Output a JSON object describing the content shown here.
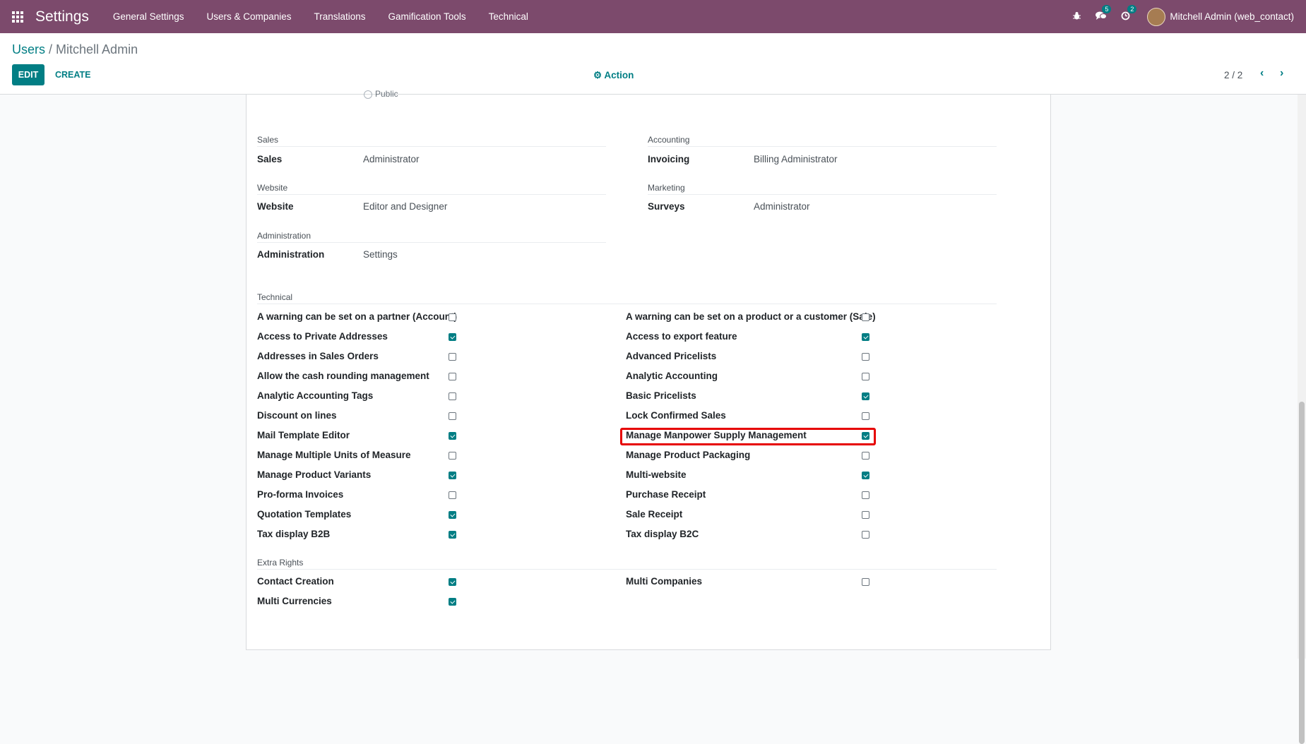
{
  "navbar": {
    "brand": "Settings",
    "menu": [
      "General Settings",
      "Users & Companies",
      "Translations",
      "Gamification Tools",
      "Technical"
    ],
    "chat_badge": "5",
    "activity_badge": "2",
    "user": "Mitchell Admin (web_contact)"
  },
  "breadcrumb": {
    "parent": "Users",
    "separator": " / ",
    "current": "Mitchell Admin"
  },
  "controls": {
    "edit": "EDIT",
    "create": "CREATE",
    "action": "Action",
    "pager": "2 / 2"
  },
  "partial_radio": "Public",
  "sections": {
    "sales": {
      "title": "Sales",
      "label": "Sales",
      "value": "Administrator"
    },
    "accounting": {
      "title": "Accounting",
      "label": "Invoicing",
      "value": "Billing Administrator"
    },
    "website": {
      "title": "Website",
      "label": "Website",
      "value": "Editor and Designer"
    },
    "marketing": {
      "title": "Marketing",
      "label": "Surveys",
      "value": "Administrator"
    },
    "administration": {
      "title": "Administration",
      "label": "Administration",
      "value": "Settings"
    }
  },
  "technical": {
    "title": "Technical",
    "left": [
      {
        "label": "A warning can be set on a partner (Account)",
        "checked": false
      },
      {
        "label": "Access to Private Addresses",
        "checked": true
      },
      {
        "label": "Addresses in Sales Orders",
        "checked": false
      },
      {
        "label": "Allow the cash rounding management",
        "checked": false
      },
      {
        "label": "Analytic Accounting Tags",
        "checked": false
      },
      {
        "label": "Discount on lines",
        "checked": false
      },
      {
        "label": "Mail Template Editor",
        "checked": true
      },
      {
        "label": "Manage Multiple Units of Measure",
        "checked": false
      },
      {
        "label": "Manage Product Variants",
        "checked": true
      },
      {
        "label": "Pro-forma Invoices",
        "checked": false
      },
      {
        "label": "Quotation Templates",
        "checked": true
      },
      {
        "label": "Tax display B2B",
        "checked": true
      }
    ],
    "right": [
      {
        "label": "A warning can be set on a product or a customer (Sale)",
        "checked": false
      },
      {
        "label": "Access to export feature",
        "checked": true
      },
      {
        "label": "Advanced Pricelists",
        "checked": false
      },
      {
        "label": "Analytic Accounting",
        "checked": false
      },
      {
        "label": "Basic Pricelists",
        "checked": true
      },
      {
        "label": "Lock Confirmed Sales",
        "checked": false
      },
      {
        "label": "Manage Manpower Supply Management",
        "checked": true
      },
      {
        "label": "Manage Product Packaging",
        "checked": false
      },
      {
        "label": "Multi-website",
        "checked": true
      },
      {
        "label": "Purchase Receipt",
        "checked": false
      },
      {
        "label": "Sale Receipt",
        "checked": false
      },
      {
        "label": "Tax display B2C",
        "checked": false
      }
    ]
  },
  "extra_rights": {
    "title": "Extra Rights",
    "left": [
      {
        "label": "Contact Creation",
        "checked": true
      },
      {
        "label": "Multi Currencies",
        "checked": true
      }
    ],
    "right": [
      {
        "label": "Multi Companies",
        "checked": false
      }
    ]
  }
}
